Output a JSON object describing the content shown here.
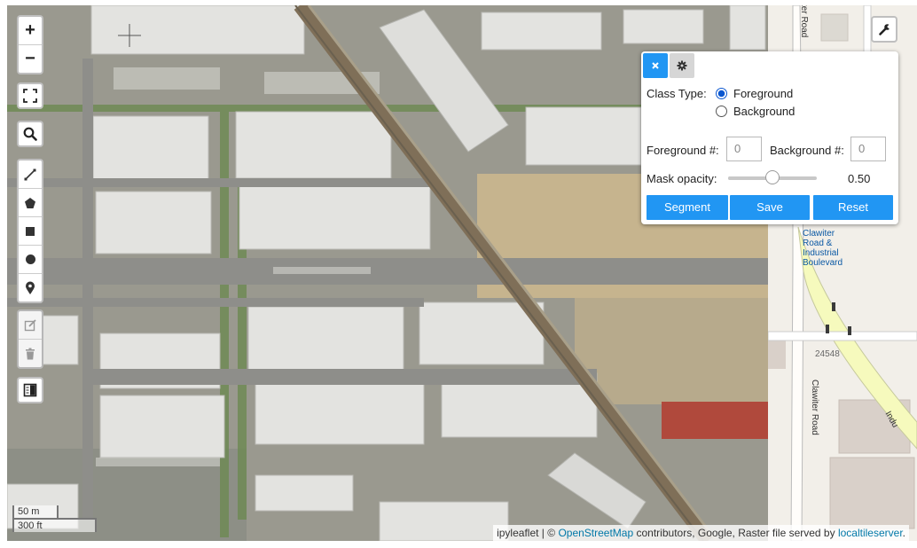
{
  "map": {
    "zoom_in": "+",
    "zoom_out": "−",
    "scale_metric": "50 m",
    "scale_imperial": "300 ft",
    "street_labels": {
      "blvd_line1": "Clawiter",
      "blvd_line2": "Road &",
      "blvd_line3": "Industrial",
      "blvd_line4": "Boulevard",
      "clawiter_top": "ter Road",
      "clawiter_bottom": "Clawiter Road",
      "house_number": "24548",
      "indu": "Indu"
    }
  },
  "toolbar_icons": [
    "fullscreen-icon",
    "search-icon",
    "polyline-icon",
    "polygon-icon",
    "rectangle-icon",
    "circle-icon",
    "marker-icon",
    "edit-icon",
    "trash-icon",
    "split-map-icon",
    "wrench-icon"
  ],
  "panel": {
    "class_type_label": "Class Type:",
    "foreground_option": "Foreground",
    "background_option": "Background",
    "selected_class": "Foreground",
    "fg_count_label": "Foreground #:",
    "fg_count_value": "0",
    "bg_count_label": "Background #:",
    "bg_count_value": "0",
    "opacity_label": "Mask opacity:",
    "opacity_value": "0.50",
    "opacity_fraction": 0.5,
    "segment_button": "Segment",
    "save_button": "Save",
    "reset_button": "Reset",
    "accent_color": "#2196f3"
  },
  "attribution": {
    "prefix": "ipyleaflet | ©",
    "osm_link": "OpenStreetMap",
    "middle": "contributors, Google, Raster file served by",
    "server_link": "localtileserver",
    "suffix": "."
  }
}
